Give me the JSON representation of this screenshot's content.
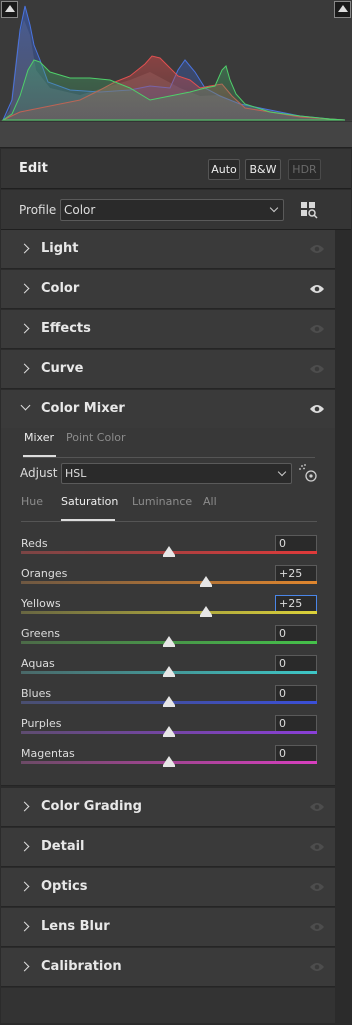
{
  "histogram": {
    "clip_left_icon": "shadow-clipping-warning-icon",
    "clip_right_icon": "highlight-clipping-warning-icon"
  },
  "edit": {
    "title": "Edit",
    "auto_label": "Auto",
    "bw_label": "B&W",
    "hdr_label": "HDR"
  },
  "profile": {
    "label": "Profile",
    "value": "Color",
    "browse_icon": "profile-browser-icon"
  },
  "panels": {
    "light": "Light",
    "color": "Color",
    "effects": "Effects",
    "curve": "Curve",
    "color_mixer": "Color Mixer",
    "color_grading": "Color Grading",
    "detail": "Detail",
    "optics": "Optics",
    "lens_blur": "Lens Blur",
    "calibration": "Calibration"
  },
  "mixer": {
    "tabs": [
      "Mixer",
      "Point Color"
    ],
    "adjust_label": "Adjust",
    "adjust_value": "HSL",
    "subtabs": [
      "Hue",
      "Saturation",
      "Luminance",
      "All"
    ],
    "active_subtab": "Saturation",
    "sliders": [
      {
        "label": "Reds",
        "value": "0",
        "colors": [
          "#7a4545",
          "#e03a3a"
        ]
      },
      {
        "label": "Oranges",
        "value": "+25",
        "colors": [
          "#6e5842",
          "#e0862e"
        ]
      },
      {
        "label": "Yellows",
        "value": "+25",
        "colors": [
          "#686642",
          "#dcd23a"
        ]
      },
      {
        "label": "Greens",
        "value": "0",
        "colors": [
          "#4c6a48",
          "#45c24a"
        ]
      },
      {
        "label": "Aquas",
        "value": "0",
        "colors": [
          "#4a6868",
          "#3ec7c7"
        ]
      },
      {
        "label": "Blues",
        "value": "0",
        "colors": [
          "#4a4f70",
          "#3a4fd8"
        ]
      },
      {
        "label": "Purples",
        "value": "0",
        "colors": [
          "#5e4c70",
          "#8a3fd8"
        ]
      },
      {
        "label": "Magentas",
        "value": "0",
        "colors": [
          "#6c4a66",
          "#d83fbf"
        ]
      }
    ]
  },
  "colors": {
    "accent_focus": "#4a86e8"
  }
}
